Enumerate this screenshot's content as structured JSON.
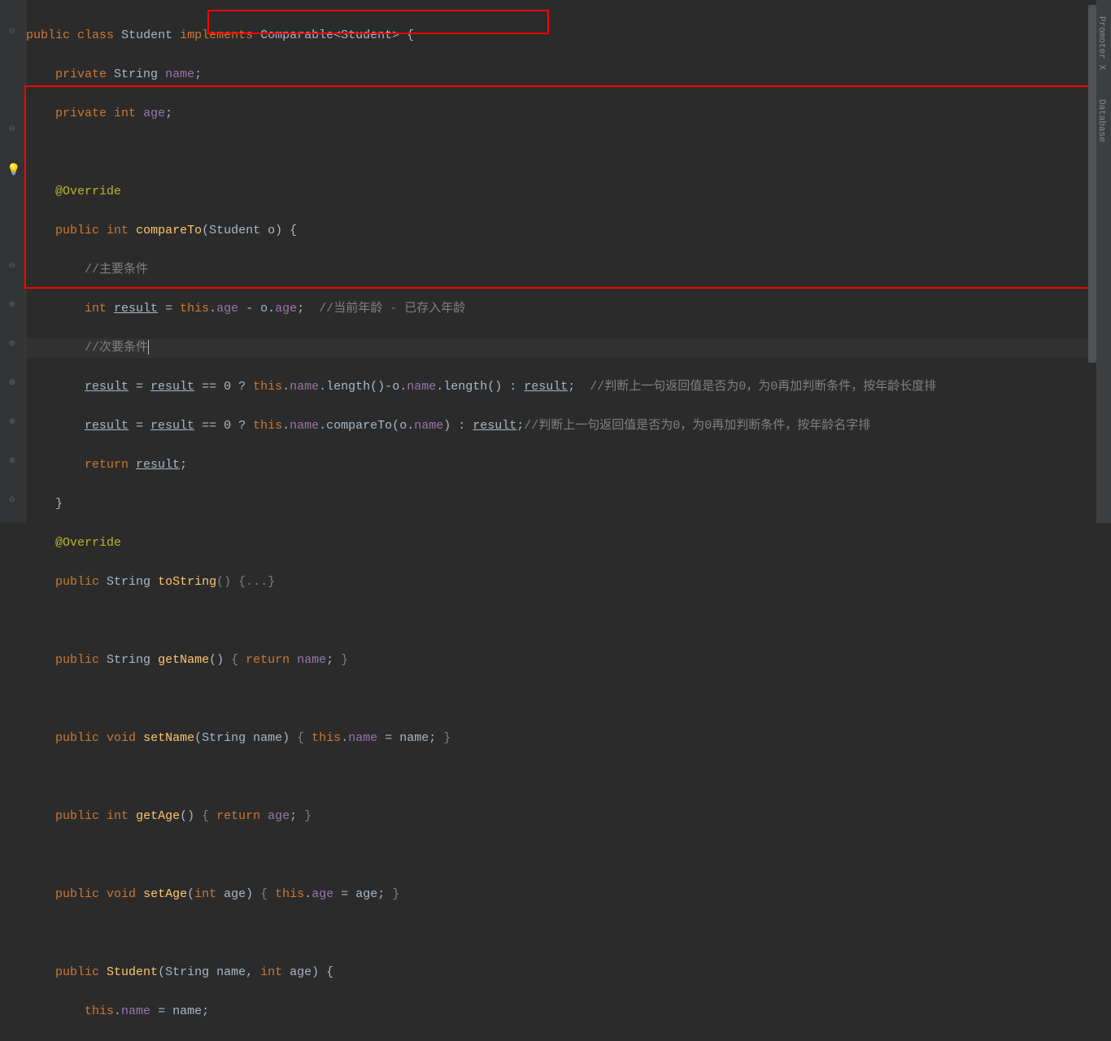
{
  "line1": {
    "kw_public": "public",
    "kw_class": "class",
    "class_name": "Student",
    "kw_implements": "implements",
    "iface": "Comparable",
    "generic": "<Student>",
    "brace": " {"
  },
  "line2": {
    "kw_private": "private",
    "type": "String",
    "field": "name",
    "semi": ";"
  },
  "line3": {
    "kw_private": "private",
    "type": "int",
    "field": "age",
    "semi": ";"
  },
  "line5": {
    "annot": "@Override"
  },
  "line6": {
    "kw_public": "public",
    "type": "int",
    "method": "compareTo",
    "param_type": "Student",
    "param_name": "o",
    "brace": ") {"
  },
  "line7": {
    "comment": "//主要条件"
  },
  "line8": {
    "type": "int",
    "var": "result",
    "eq": " = ",
    "this": "this",
    "dot": ".",
    "f1": "age",
    "minus": " - ",
    "o": "o",
    "f2": "age",
    "semi": ";",
    "comment": "  //当前年龄 - 已存入年龄"
  },
  "line9": {
    "comment": "//次要条件"
  },
  "line10": {
    "v1": "result",
    "eq": " = ",
    "v2": "result",
    "cmp": " == ",
    "zero": "0",
    "q": " ? ",
    "this": "this",
    "dot": ".",
    "name": "name",
    "len": ".length()",
    "minus": "-",
    "o": "o",
    "len2": ".length()",
    "colon": " : ",
    "v3": "result",
    "semi": ";",
    "comment": "  //判断上一句返回值是否为0，为0再加判断条件，按年龄长度排"
  },
  "line11": {
    "v1": "result",
    "eq": " = ",
    "v2": "result",
    "cmp": " == ",
    "zero": "0",
    "q": " ? ",
    "this": "this",
    "dot": ".",
    "name": "name",
    "cmpTo": ".compareTo(",
    "o": "o",
    "name2": "name",
    "close": ")",
    "colon": " : ",
    "v3": "result",
    "semi": ";",
    "comment": "//判断上一句返回值是否为0，为0再加判断条件，按年龄名字排"
  },
  "line12": {
    "kw_return": "return",
    "var": "result",
    "semi": ";"
  },
  "line13": {
    "brace": "}"
  },
  "line14": {
    "annot": "@Override"
  },
  "line15": {
    "kw_public": "public",
    "type": "String",
    "method": "toString",
    "fold": "() {...}"
  },
  "line17": {
    "kw_public": "public",
    "type": "String",
    "method": "getName",
    "paren": "()",
    "brace": " { ",
    "kw_return": "return",
    "var": " name",
    "semi": ";",
    "close": " }"
  },
  "line19": {
    "kw_public": "public",
    "type": "void",
    "method": "setName",
    "paren_o": "(",
    "param_t": "String",
    "param_n": " name",
    "paren_c": ")",
    "brace": " { ",
    "this": "this",
    "dot": ".",
    "f": "name",
    "eq": " = ",
    "p": "name",
    "semi": ";",
    "close": " }"
  },
  "line21": {
    "kw_public": "public",
    "type": "int",
    "method": "getAge",
    "paren": "()",
    "brace": " { ",
    "kw_return": "return",
    "var": " age",
    "semi": ";",
    "close": " }"
  },
  "line23": {
    "kw_public": "public",
    "type": "void",
    "method": "setAge",
    "paren_o": "(",
    "param_t": "int",
    "param_n": " age",
    "paren_c": ")",
    "brace": " { ",
    "this": "this",
    "dot": ".",
    "f": "age",
    "eq": " = ",
    "p": "age",
    "semi": ";",
    "close": " }"
  },
  "line25": {
    "kw_public": "public",
    "method": "Student",
    "paren_o": "(",
    "p1t": "String",
    "p1n": " name",
    "comma": ",",
    "p2t": " int",
    "p2n": " age",
    "paren_c": ")",
    "brace": " {"
  },
  "line26": {
    "this": "this",
    "dot": ".",
    "f": "name",
    "eq": " = ",
    "p": "name",
    "semi": ";"
  },
  "rightTabs": {
    "t1": "Promoter X",
    "t2": "Database"
  }
}
